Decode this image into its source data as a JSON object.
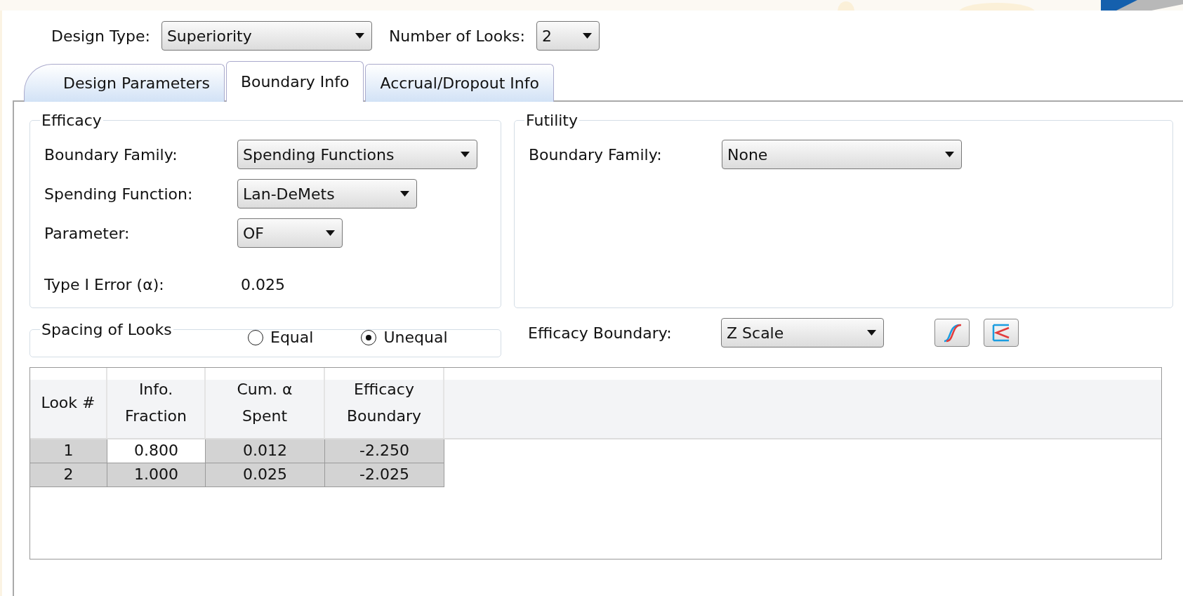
{
  "top_fields": [
    {
      "label": "Design Type:",
      "value": "Superiority"
    },
    {
      "label": "Number of Looks:",
      "value": "2"
    }
  ],
  "tabs": [
    {
      "label": "Design Parameters",
      "selected": false
    },
    {
      "label": "Boundary Info",
      "selected": true
    },
    {
      "label": "Accrual/Dropout Info",
      "selected": false
    }
  ],
  "efficacy": {
    "title": "Efficacy",
    "rows": [
      {
        "kind": "dropdown",
        "label": "Boundary Family:",
        "value": "Spending Functions"
      },
      {
        "kind": "dropdown",
        "label": "Spending Function:",
        "value": "Lan-DeMets"
      },
      {
        "kind": "dropdown",
        "label": "Parameter:",
        "value": "OF"
      },
      {
        "kind": "text",
        "label": "Type I Error (α):",
        "value": "0.025"
      }
    ]
  },
  "futility": {
    "title": "Futility",
    "rows": [
      {
        "kind": "dropdown",
        "label": "Boundary Family:",
        "value": "None"
      }
    ]
  },
  "spacing": {
    "title": "Spacing of Looks",
    "options": [
      {
        "label": "Equal",
        "selected": false
      },
      {
        "label": "Unequal",
        "selected": true
      }
    ]
  },
  "efficacy_boundary": {
    "label": "Efficacy Boundary:",
    "value": "Z Scale"
  },
  "table": {
    "columns": [
      "Look #",
      "Info. Fraction",
      "Cum. α Spent",
      "Efficacy Boundary"
    ],
    "rows": [
      {
        "cells": [
          {
            "text": "1",
            "editable": false
          },
          {
            "text": "0.800",
            "editable": true
          },
          {
            "text": "0.012",
            "editable": false
          },
          {
            "text": "-2.250",
            "editable": false
          }
        ]
      },
      {
        "cells": [
          {
            "text": "2",
            "editable": false
          },
          {
            "text": "1.000",
            "editable": false
          },
          {
            "text": "0.025",
            "editable": false
          },
          {
            "text": "-2.025",
            "editable": false
          }
        ]
      }
    ]
  }
}
